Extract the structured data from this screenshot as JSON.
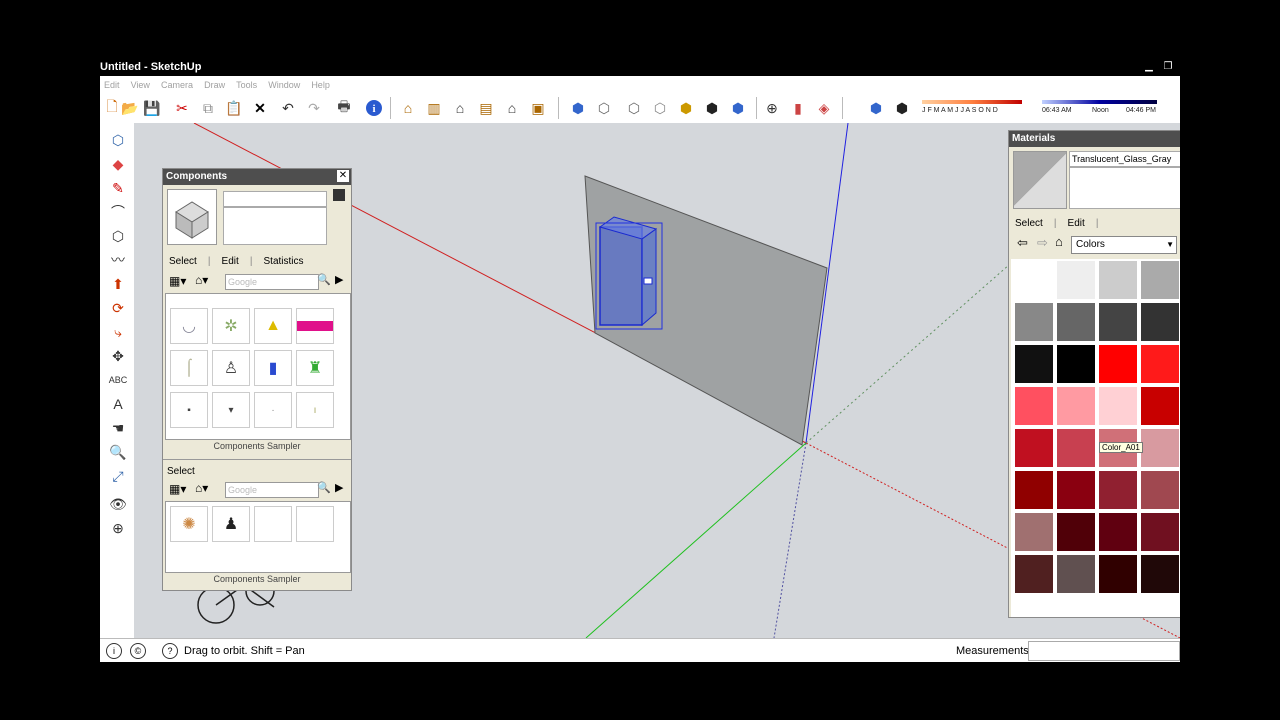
{
  "window": {
    "title": "Untitled - SketchUp"
  },
  "menu": [
    "Edit",
    "View",
    "Camera",
    "Draw",
    "Tools",
    "Window",
    "Help"
  ],
  "shadow_bar": {
    "months": "J F M A M J J A S O N D",
    "time_start": "06:43 AM",
    "time_mid": "Noon",
    "time_end": "04:46 PM"
  },
  "components": {
    "title": "Components",
    "tabs": [
      "Select",
      "Edit",
      "Statistics"
    ],
    "search_placeholder": "Google",
    "footer": "Components Sampler",
    "second_section_label": "Select",
    "second_search_placeholder": "Google",
    "second_footer": "Components Sampler"
  },
  "materials": {
    "title": "Materials",
    "material_name": "Translucent_Glass_Gray",
    "tabs": [
      "Select",
      "Edit"
    ],
    "collection": "Colors",
    "tooltip": "Color_A01",
    "swatches": [
      "#ffffff",
      "#eeeeee",
      "#cccccc",
      "#aaaaaa",
      "#888888",
      "#666666",
      "#444444",
      "#333333",
      "#111111",
      "#000000",
      "#ff0000",
      "#ff1a1a",
      "#ff5060",
      "#ff9aa2",
      "#ffd0d4",
      "#c80000",
      "#c01020",
      "#c84050",
      "#d07078",
      "#d89aa0",
      "#900000",
      "#8a0010",
      "#902030",
      "#a04850",
      "#a07070",
      "#500008",
      "#600010",
      "#701020",
      "#502020",
      "#605050",
      "#300000",
      "#200808"
    ]
  },
  "status": {
    "hint": "Drag to orbit.  Shift = Pan",
    "measurements_label": "Measurements"
  }
}
